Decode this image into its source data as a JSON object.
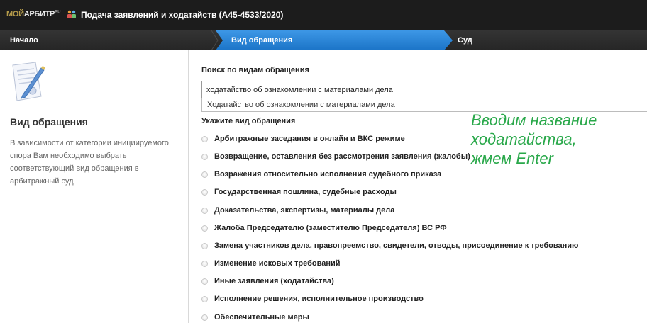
{
  "topbar": {
    "logo_prefix": "МОЙ",
    "logo_main": "АРБИТР",
    "logo_suffix": "RU",
    "title": "Подача заявлений и ходатайств  (А45-4533/2020)",
    "icon": "people-group-icon"
  },
  "steps": [
    {
      "label": "Начало",
      "active": false
    },
    {
      "label": "Вид обращения",
      "active": true
    },
    {
      "label": "Суд",
      "active": false
    }
  ],
  "colors": {
    "active_step": "#1f83d8",
    "annotation": "#29a84a",
    "topbar": "#1c1c1c"
  },
  "left": {
    "icon": "document-pen-icon",
    "title": "Вид обращения",
    "description": "В зависимости от категории инициируемого спора Вам необходимо выбрать соответствующий вид обращения в арбитражный суд"
  },
  "search": {
    "label": "Поиск по видам обращения",
    "value": "ходатайство об ознакомлении с материалами дела",
    "suggestion": "Ходатайство об ознакомлении с материалами дела"
  },
  "types": {
    "label": "Укажите вид обращения",
    "options": [
      "Арбитражные заседания в онлайн и ВКС режиме",
      "Возвращение, оставления без рассмотрения заявления (жалобы)",
      "Возражения относительно исполнения судебного приказа",
      "Государственная пошлина, судебные расходы",
      "Доказательства, экспертизы, материалы дела",
      "Жалоба Председателю (заместителю Председателя) ВС РФ",
      "Замена участников дела, правопреемство, свидетели, отводы, присоединение к требованию",
      "Изменение исковых требований",
      "Иные заявления (ходатайства)",
      "Исполнение решения, исполнительное производство",
      "Обеспечительные меры"
    ]
  },
  "annotation": {
    "lines": [
      "Вводим название",
      "ходатайства,",
      "жмем Enter"
    ]
  }
}
